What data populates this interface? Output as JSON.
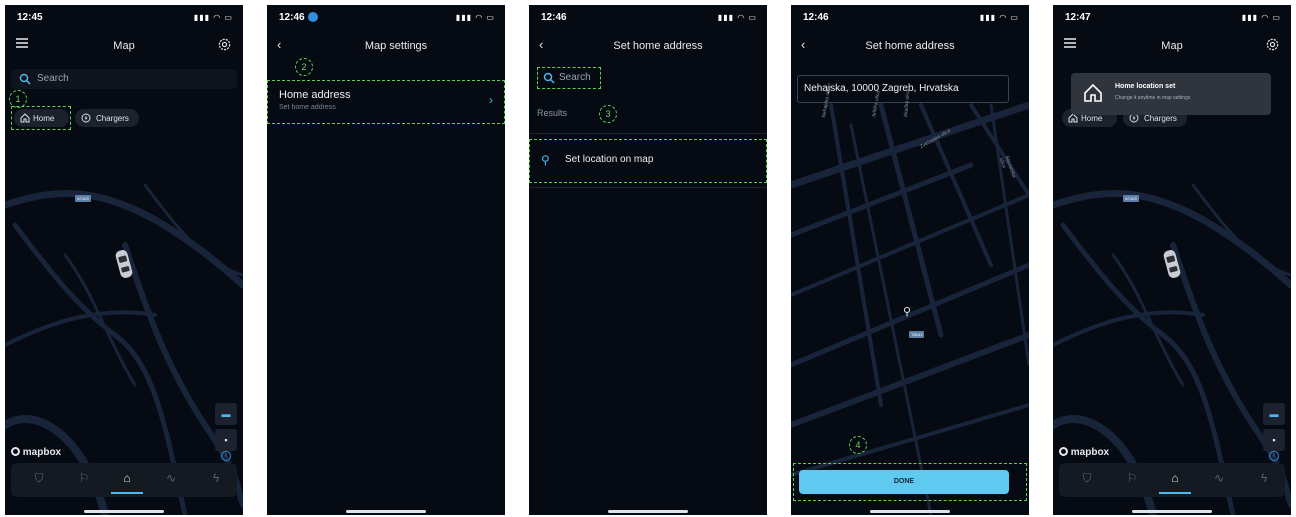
{
  "colors": {
    "background": "#060a12",
    "accent": "#4cb8ec",
    "annotation": "#5fd14a",
    "done_button": "#5fc9f0"
  },
  "screen1": {
    "time": "12:45",
    "title": "Map",
    "search_placeholder": "Search",
    "chips": [
      "Home",
      "Chargers"
    ],
    "marker": "1",
    "road_badge": "A7103",
    "mapbox": "mapbox",
    "tabs": [
      "shield-icon",
      "flag-icon",
      "map-pin-icon",
      "route-icon",
      "bolt-icon"
    ]
  },
  "screen2": {
    "time": "12:46",
    "title": "Map settings",
    "marker": "2",
    "row_title": "Home address",
    "row_sub": "Set home address"
  },
  "screen3": {
    "time": "12:46",
    "title": "Set home address",
    "search_placeholder": "Search",
    "results_label": "Results",
    "marker": "3",
    "set_location": "Set location on map"
  },
  "screen4": {
    "time": "12:46",
    "title": "Set home address",
    "address_value": "Nehajska, 10000 Zagreb, Hrvatska",
    "marker": "4",
    "done_label": "DONE",
    "road_badge": "T8041",
    "streets": [
      "Nehajska ulica",
      "Jelička ulica",
      "Akačka ulica",
      "Zvečajska ulica",
      "Slavonska ulica"
    ]
  },
  "screen5": {
    "time": "12:47",
    "title": "Map",
    "toast_title": "Home location set",
    "toast_sub": "Change it anytime in map settings",
    "chips": [
      "Home",
      "Chargers"
    ],
    "road_badge": "A7103",
    "mapbox": "mapbox"
  }
}
